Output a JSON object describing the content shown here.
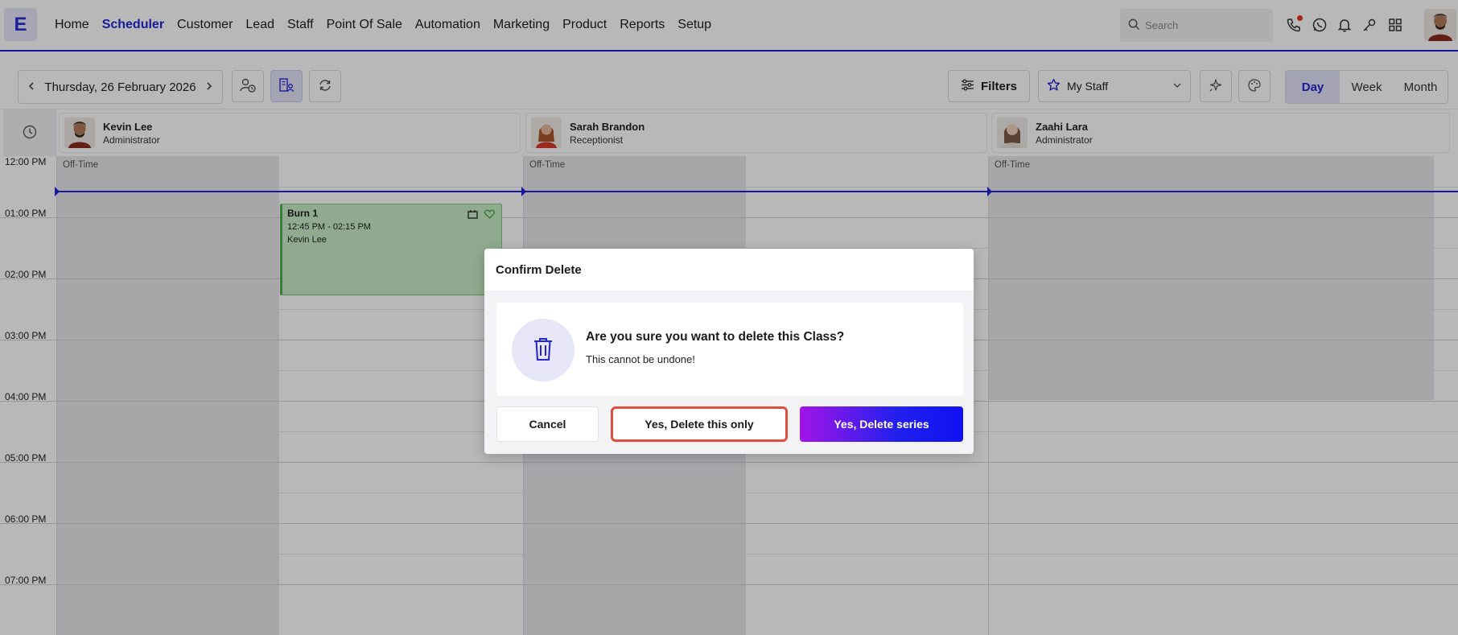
{
  "app": {
    "logo_letter": "E",
    "nav": [
      "Home",
      "Scheduler",
      "Customer",
      "Lead",
      "Staff",
      "Point Of Sale",
      "Automation",
      "Marketing",
      "Product",
      "Reports",
      "Setup"
    ],
    "active_nav": "Scheduler",
    "search_placeholder": "Search",
    "accent_color": "#2424d4"
  },
  "toolbar": {
    "date": "Thursday, 26 February 2026",
    "filters_label": "Filters",
    "staff_select": "My Staff",
    "views": [
      "Day",
      "Week",
      "Month"
    ],
    "active_view": "Day"
  },
  "staff": [
    {
      "name": "Kevin Lee",
      "role": "Administrator"
    },
    {
      "name": "Sarah Brandon",
      "role": "Receptionist"
    },
    {
      "name": "Zaahi Lara",
      "role": "Administrator"
    }
  ],
  "time_labels": [
    "12:00 PM",
    "01:00 PM",
    "02:00 PM",
    "03:00 PM",
    "04:00 PM",
    "05:00 PM",
    "06:00 PM",
    "07:00 PM"
  ],
  "off_time_label": "Off-Time",
  "event": {
    "title": "Burn 1",
    "time": "12:45 PM - 02:15 PM",
    "staff": "Kevin Lee",
    "color": "#c7ecc5"
  },
  "modal": {
    "title": "Confirm Delete",
    "question": "Are you sure you want to delete this Class?",
    "subtext": "This cannot be undone!",
    "cancel_label": "Cancel",
    "delete_this_label": "Yes, Delete this only",
    "delete_series_label": "Yes, Delete series"
  }
}
